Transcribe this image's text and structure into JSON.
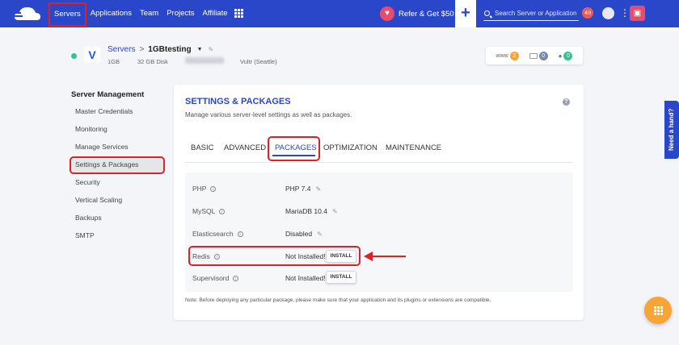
{
  "topbar": {
    "nav": [
      "Servers",
      "Applications",
      "Team",
      "Projects",
      "Affiliate"
    ],
    "refer_label": "Refer & Get $50",
    "search_placeholder": "Search Server or Application",
    "notification_count": "49",
    "plus_label": "+",
    "more_label": "⋮"
  },
  "server": {
    "breadcrumb_root": "Servers",
    "breadcrumb_sep": ">",
    "name": "1GBtesting",
    "ram": "1GB",
    "disk": "32 GB Disk",
    "provider": "Vultr (Seattle)",
    "stats": [
      {
        "label": "www",
        "count": "2",
        "color": "#f7a537"
      },
      {
        "label": "",
        "count": "0",
        "color": "#7b87a8"
      },
      {
        "label": "",
        "count": "0",
        "color": "#34c38f"
      }
    ]
  },
  "sidebar": {
    "title": "Server Management",
    "items": [
      "Master Credentials",
      "Monitoring",
      "Manage Services",
      "Settings & Packages",
      "Security",
      "Vertical Scaling",
      "Backups",
      "SMTP"
    ]
  },
  "card": {
    "title": "SETTINGS & PACKAGES",
    "subtitle": "Manage various server-level settings as well as packages.",
    "help": "?",
    "tabs": [
      "BASIC",
      "ADVANCED",
      "PACKAGES",
      "OPTIMIZATION",
      "MAINTENANCE"
    ],
    "packages": [
      {
        "label": "PHP",
        "value": "PHP 7.4"
      },
      {
        "label": "MySQL",
        "value": "MariaDB 10.4"
      },
      {
        "label": "Elasticsearch",
        "value": "Disabled"
      },
      {
        "label": "Redis",
        "value": "Not Installed!"
      },
      {
        "label": "Supervisord",
        "value": "Not Installed!"
      }
    ],
    "install_label": "INSTALL",
    "note": "Note: Before deploying any particular package, please make sure that your application and its plugins or extensions are compatible."
  },
  "help_tab": "Need a hand?",
  "colors": {
    "brand": "#2b47c9",
    "highlight": "#d8232a",
    "accent": "#f7a537"
  }
}
